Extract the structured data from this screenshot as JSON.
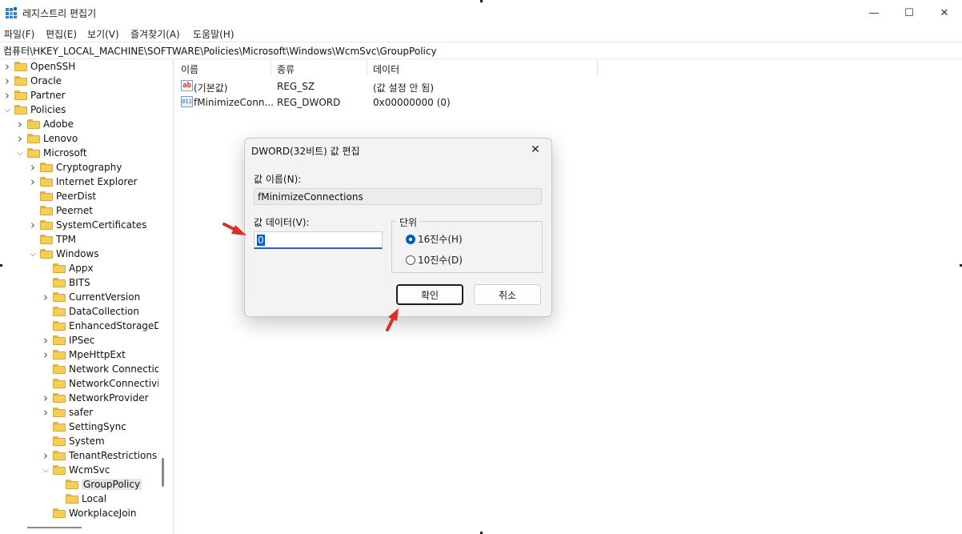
{
  "window": {
    "title": "레지스트리 편집기",
    "controls": {
      "minimize": "—",
      "maximize": "☐",
      "close": "✕"
    }
  },
  "menu": [
    "파일(F)",
    "편집(E)",
    "보기(V)",
    "즐겨찾기(A)",
    "도움말(H)"
  ],
  "address": "컴퓨터\\HKEY_LOCAL_MACHINE\\SOFTWARE\\Policies\\Microsoft\\Windows\\WcmSvc\\GroupPolicy",
  "tree": [
    {
      "label": "OpenSSH",
      "level": 0,
      "expander": "closed"
    },
    {
      "label": "Oracle",
      "level": 0,
      "expander": "closed"
    },
    {
      "label": "Partner",
      "level": 0,
      "expander": "closed"
    },
    {
      "label": "Policies",
      "level": 0,
      "expander": "open"
    },
    {
      "label": "Adobe",
      "level": 1,
      "expander": "closed"
    },
    {
      "label": "Lenovo",
      "level": 1,
      "expander": "closed"
    },
    {
      "label": "Microsoft",
      "level": 1,
      "expander": "open"
    },
    {
      "label": "Cryptography",
      "level": 2,
      "expander": "closed"
    },
    {
      "label": "Internet Explorer",
      "level": 2,
      "expander": "closed"
    },
    {
      "label": "PeerDist",
      "level": 2,
      "expander": "none"
    },
    {
      "label": "Peernet",
      "level": 2,
      "expander": "none"
    },
    {
      "label": "SystemCertificates",
      "level": 2,
      "expander": "closed"
    },
    {
      "label": "TPM",
      "level": 2,
      "expander": "none"
    },
    {
      "label": "Windows",
      "level": 2,
      "expander": "open"
    },
    {
      "label": "Appx",
      "level": 3,
      "expander": "none"
    },
    {
      "label": "BITS",
      "level": 3,
      "expander": "none"
    },
    {
      "label": "CurrentVersion",
      "level": 3,
      "expander": "closed"
    },
    {
      "label": "DataCollection",
      "level": 3,
      "expander": "none"
    },
    {
      "label": "EnhancedStorageDe",
      "level": 3,
      "expander": "none"
    },
    {
      "label": "IPSec",
      "level": 3,
      "expander": "closed"
    },
    {
      "label": "MpeHttpExt",
      "level": 3,
      "expander": "closed"
    },
    {
      "label": "Network Connection",
      "level": 3,
      "expander": "none"
    },
    {
      "label": "NetworkConnectivity",
      "level": 3,
      "expander": "none"
    },
    {
      "label": "NetworkProvider",
      "level": 3,
      "expander": "closed"
    },
    {
      "label": "safer",
      "level": 3,
      "expander": "closed"
    },
    {
      "label": "SettingSync",
      "level": 3,
      "expander": "none"
    },
    {
      "label": "System",
      "level": 3,
      "expander": "none"
    },
    {
      "label": "TenantRestrictions",
      "level": 3,
      "expander": "closed"
    },
    {
      "label": "WcmSvc",
      "level": 3,
      "expander": "open"
    },
    {
      "label": "GroupPolicy",
      "level": 4,
      "expander": "none",
      "selected": true
    },
    {
      "label": "Local",
      "level": 4,
      "expander": "none"
    },
    {
      "label": "WorkplaceJoin",
      "level": 3,
      "expander": "none"
    }
  ],
  "list": {
    "headers": {
      "name": "이름",
      "type": "종류",
      "data": "데이터"
    },
    "rows": [
      {
        "icon": "string-value-icon",
        "icon_text": "ab",
        "name": "(기본값)",
        "type": "REG_SZ",
        "data": "(값 설정 안 됨)"
      },
      {
        "icon": "binary-value-icon",
        "icon_text": "011",
        "name": "fMinimizeConn...",
        "type": "REG_DWORD",
        "data": "0x00000000 (0)"
      }
    ]
  },
  "dialog": {
    "title": "DWORD(32비트) 값 편집",
    "close": "✕",
    "name_label": "값 이름(N):",
    "name_value": "fMinimizeConnections",
    "data_label": "값 데이터(V):",
    "data_value": "0",
    "base_legend": "단위",
    "base_options": [
      {
        "label": "16진수(H)",
        "checked": true
      },
      {
        "label": "10진수(D)",
        "checked": false
      }
    ],
    "ok": "확인",
    "cancel": "취소"
  },
  "colors": {
    "annotation_arrow": "#d9302c",
    "selection": "#0060d4",
    "folder": "#f7cd5a"
  }
}
